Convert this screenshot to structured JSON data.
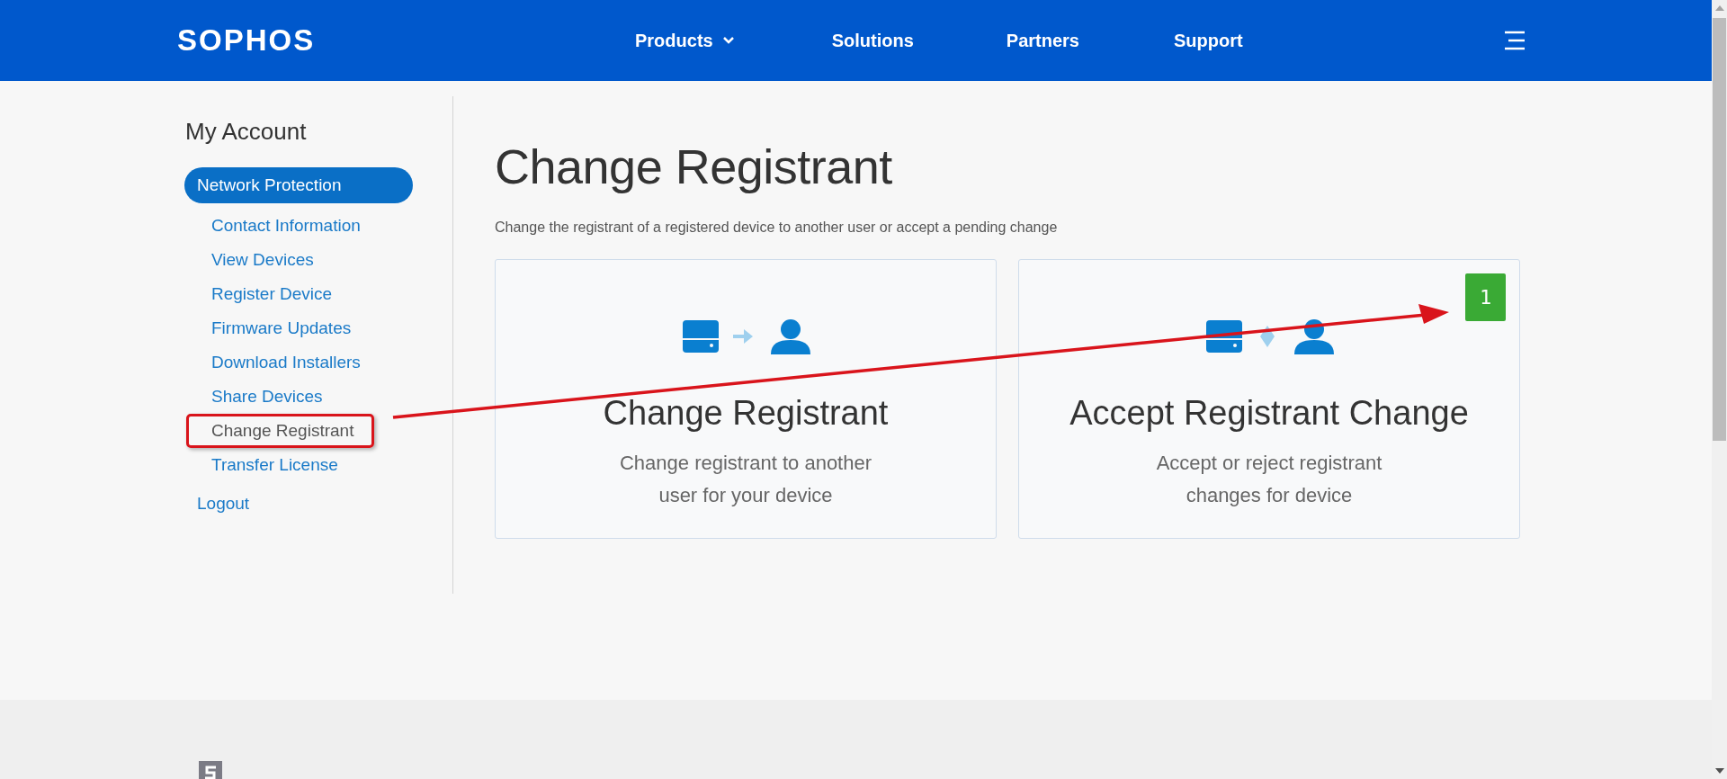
{
  "header": {
    "logo": "SOPHOS",
    "nav": [
      {
        "label": "Products",
        "dropdown": true
      },
      {
        "label": "Solutions",
        "dropdown": false
      },
      {
        "label": "Partners",
        "dropdown": false
      },
      {
        "label": "Support",
        "dropdown": false
      }
    ]
  },
  "sidebar": {
    "title": "My Account",
    "items": [
      {
        "label": "Network Protection",
        "selected": true,
        "children": [
          {
            "label": "Contact Information",
            "highlighted": false
          },
          {
            "label": "View Devices",
            "highlighted": false
          },
          {
            "label": "Register Device",
            "highlighted": false
          },
          {
            "label": "Firmware Updates",
            "highlighted": false
          },
          {
            "label": "Download Installers",
            "highlighted": false
          },
          {
            "label": "Share Devices",
            "highlighted": false
          },
          {
            "label": "Change Registrant",
            "highlighted": true
          },
          {
            "label": "Transfer License",
            "highlighted": false
          }
        ]
      },
      {
        "label": "Logout",
        "selected": false
      }
    ]
  },
  "main": {
    "title": "Change Registrant",
    "subtitle": "Change the registrant of a registered device to another user or accept a pending change",
    "cards": [
      {
        "kind": "send",
        "title": "Change Registrant",
        "description": "Change registrant to another user for your device"
      },
      {
        "kind": "swap",
        "title": "Accept Registrant Change",
        "description": "Accept or reject registrant changes for device",
        "badge": "1"
      }
    ]
  }
}
